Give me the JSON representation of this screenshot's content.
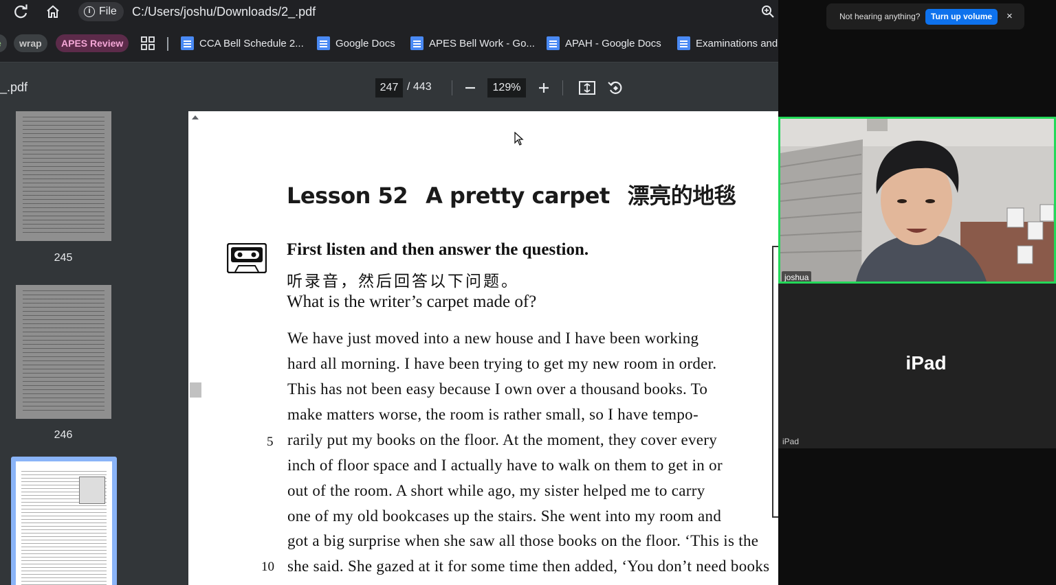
{
  "browser": {
    "file_chip_label": "File",
    "url": "C:/Users/joshu/Downloads/2_.pdf",
    "bookmarks": {
      "chip_partial": "e",
      "wrap": "wrap",
      "apes_review": "APES Review",
      "items": [
        "CCA Bell Schedule 2...",
        "Google Docs",
        "APES Bell Work - Go...",
        "APAH - Google Docs",
        "Examinations and"
      ]
    },
    "colors": {
      "wrap_chip": "#3c4043",
      "apes_chip": "#5c2b4a",
      "apes_text": "#f4a6d6",
      "doc_icon": "#4a8af4"
    }
  },
  "pdf": {
    "title": "_.pdf",
    "current_page": "247",
    "total_pages": "/ 443",
    "zoom": "129%",
    "thumbnails": [
      "245",
      "246"
    ],
    "page": {
      "lesson_number": "Lesson 52",
      "lesson_title_en": "A pretty carpet",
      "lesson_title_zh": "漂亮的地毯",
      "instruction_en": "First listen and then answer the question.",
      "instruction_zh": "听录音，然后回答以下问题。",
      "question": "What is the writer’s carpet made of?",
      "paragraph_lines": [
        "We have just moved into a new house and I have been working",
        "hard all morning. I have been trying to get my new room in order.",
        "This has not been easy because I own over a thousand books. To",
        "make matters worse, the room is rather small, so I have tempo-",
        "rarily put my books on the floor. At the moment, they cover every",
        "inch of floor space and I actually have to walk on them to get in or",
        "out of the room. A short while ago, my sister helped me to carry",
        "one of my old bookcases up the stairs. She went into my room and",
        "got a big surprise when she saw all those books on the floor. ‘This is the",
        "she said. She gazed at it for some time then added, ‘You don’t need books"
      ],
      "line_numbers": {
        "five": "5",
        "ten": "10"
      }
    }
  },
  "meeting": {
    "toast_message": "Not hearing anything?",
    "toast_button": "Turn up volume",
    "toast_close": "×",
    "participant_1": "joshua",
    "participant_2_big": "iPad",
    "participant_2_tag": "iPad",
    "colors": {
      "active_speaker": "#23d959",
      "toast_button": "#0e72ed"
    }
  }
}
